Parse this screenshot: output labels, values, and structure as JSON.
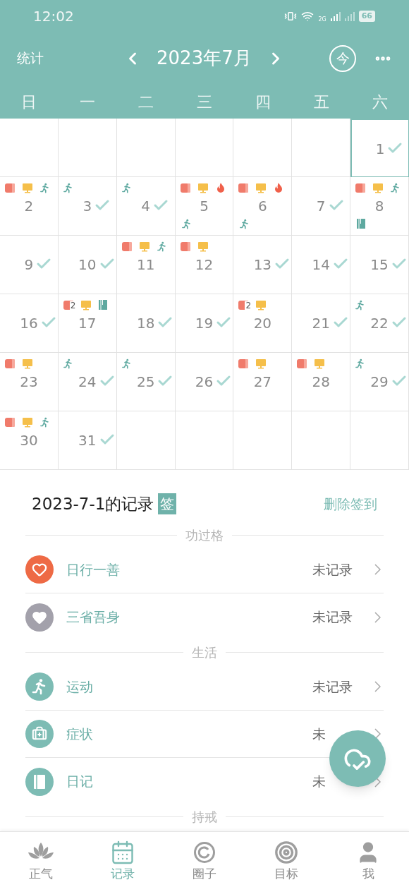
{
  "status_bar": {
    "time": "12:02",
    "network": "2G",
    "battery": "66"
  },
  "header": {
    "left": "统计",
    "title": "2023年7月",
    "today": "今"
  },
  "weekdays": [
    "日",
    "一",
    "二",
    "三",
    "四",
    "五",
    "六"
  ],
  "calendar": [
    [
      {
        "kind": "empty"
      },
      {
        "kind": "empty"
      },
      {
        "kind": "empty"
      },
      {
        "kind": "empty"
      },
      {
        "kind": "empty"
      },
      {
        "kind": "empty"
      },
      {
        "kind": "day",
        "day": "1",
        "checked": true,
        "selected": true
      }
    ],
    [
      {
        "kind": "day",
        "day": "2",
        "checked": false,
        "selected": false,
        "top": [
          {
            "kind": "book"
          },
          {
            "kind": "monitor"
          },
          {
            "kind": "run"
          }
        ]
      },
      {
        "kind": "day",
        "day": "3",
        "checked": true,
        "selected": false,
        "top": [
          {
            "kind": "run"
          }
        ]
      },
      {
        "kind": "day",
        "day": "4",
        "checked": true,
        "selected": false,
        "top": [
          {
            "kind": "run"
          }
        ]
      },
      {
        "kind": "day",
        "day": "5",
        "checked": false,
        "selected": false,
        "top": [
          {
            "kind": "book"
          },
          {
            "kind": "monitor"
          },
          {
            "kind": "fire"
          }
        ],
        "bottom": [
          {
            "kind": "run"
          }
        ]
      },
      {
        "kind": "day",
        "day": "6",
        "checked": false,
        "selected": false,
        "top": [
          {
            "kind": "book"
          },
          {
            "kind": "monitor"
          },
          {
            "kind": "fire"
          }
        ],
        "bottom": [
          {
            "kind": "run"
          }
        ]
      },
      {
        "kind": "day",
        "day": "7",
        "checked": true,
        "selected": false
      },
      {
        "kind": "day",
        "day": "8",
        "checked": false,
        "selected": false,
        "top": [
          {
            "kind": "book"
          },
          {
            "kind": "monitor"
          },
          {
            "kind": "run"
          }
        ],
        "bottom": [
          {
            "kind": "diary"
          }
        ]
      }
    ],
    [
      {
        "kind": "day",
        "day": "9",
        "checked": true,
        "selected": false
      },
      {
        "kind": "day",
        "day": "10",
        "checked": true,
        "selected": false
      },
      {
        "kind": "day",
        "day": "11",
        "checked": false,
        "selected": false,
        "top": [
          {
            "kind": "book"
          },
          {
            "kind": "monitor"
          },
          {
            "kind": "run"
          }
        ]
      },
      {
        "kind": "day",
        "day": "12",
        "checked": false,
        "selected": false,
        "top": [
          {
            "kind": "book"
          },
          {
            "kind": "monitor"
          }
        ]
      },
      {
        "kind": "day",
        "day": "13",
        "checked": true,
        "selected": false
      },
      {
        "kind": "day",
        "day": "14",
        "checked": true,
        "selected": false
      },
      {
        "kind": "day",
        "day": "15",
        "checked": true,
        "selected": false
      }
    ],
    [
      {
        "kind": "day",
        "day": "16",
        "checked": true,
        "selected": false
      },
      {
        "kind": "day",
        "day": "17",
        "checked": false,
        "selected": false,
        "top": [
          {
            "kind": "book",
            "count": "2"
          },
          {
            "kind": "monitor"
          },
          {
            "kind": "diary"
          }
        ]
      },
      {
        "kind": "day",
        "day": "18",
        "checked": true,
        "selected": false
      },
      {
        "kind": "day",
        "day": "19",
        "checked": true,
        "selected": false
      },
      {
        "kind": "day",
        "day": "20",
        "checked": false,
        "selected": false,
        "top": [
          {
            "kind": "book",
            "count": "2"
          },
          {
            "kind": "monitor"
          }
        ]
      },
      {
        "kind": "day",
        "day": "21",
        "checked": true,
        "selected": false
      },
      {
        "kind": "day",
        "day": "22",
        "checked": true,
        "selected": false,
        "top": [
          {
            "kind": "run"
          }
        ]
      }
    ],
    [
      {
        "kind": "day",
        "day": "23",
        "checked": false,
        "selected": false,
        "top": [
          {
            "kind": "book"
          },
          {
            "kind": "monitor"
          }
        ]
      },
      {
        "kind": "day",
        "day": "24",
        "checked": true,
        "selected": false,
        "top": [
          {
            "kind": "run"
          }
        ]
      },
      {
        "kind": "day",
        "day": "25",
        "checked": true,
        "selected": false,
        "top": [
          {
            "kind": "run"
          }
        ]
      },
      {
        "kind": "day",
        "day": "26",
        "checked": true,
        "selected": false
      },
      {
        "kind": "day",
        "day": "27",
        "checked": false,
        "selected": false,
        "top": [
          {
            "kind": "book"
          },
          {
            "kind": "monitor"
          }
        ]
      },
      {
        "kind": "day",
        "day": "28",
        "checked": false,
        "selected": false,
        "top": [
          {
            "kind": "book"
          },
          {
            "kind": "monitor"
          }
        ]
      },
      {
        "kind": "day",
        "day": "29",
        "checked": true,
        "selected": false,
        "top": [
          {
            "kind": "run"
          }
        ]
      }
    ],
    [
      {
        "kind": "day",
        "day": "30",
        "checked": false,
        "selected": false,
        "top": [
          {
            "kind": "book"
          },
          {
            "kind": "monitor"
          },
          {
            "kind": "run"
          }
        ]
      },
      {
        "kind": "day",
        "day": "31",
        "checked": true,
        "selected": false
      },
      {
        "kind": "empty"
      },
      {
        "kind": "empty"
      },
      {
        "kind": "empty"
      },
      {
        "kind": "empty"
      },
      {
        "kind": "empty"
      }
    ]
  ],
  "record": {
    "title": "2023-7-1的记录",
    "badge": "签",
    "action": "删除签到"
  },
  "sections": [
    {
      "title": "功过格",
      "items": [
        {
          "kind": "heart",
          "label": "日行一善",
          "status": "未记录"
        },
        {
          "kind": "broken-heart",
          "label": "三省吾身",
          "status": "未记录"
        }
      ]
    },
    {
      "title": "生活",
      "items": [
        {
          "kind": "run",
          "label": "运动",
          "status": "未记录"
        },
        {
          "kind": "medkit",
          "label": "症状",
          "status": "未"
        },
        {
          "kind": "diary",
          "label": "日记",
          "status": "未"
        }
      ]
    },
    {
      "title": "持戒"
    }
  ],
  "nav": [
    {
      "kind": "lotus",
      "label": "正气",
      "selected": false
    },
    {
      "kind": "calendar",
      "label": "记录",
      "selected": true
    },
    {
      "kind": "ring",
      "label": "圈子",
      "selected": false
    },
    {
      "kind": "target",
      "label": "目标",
      "selected": false
    },
    {
      "kind": "user",
      "label": "我",
      "selected": false
    }
  ]
}
